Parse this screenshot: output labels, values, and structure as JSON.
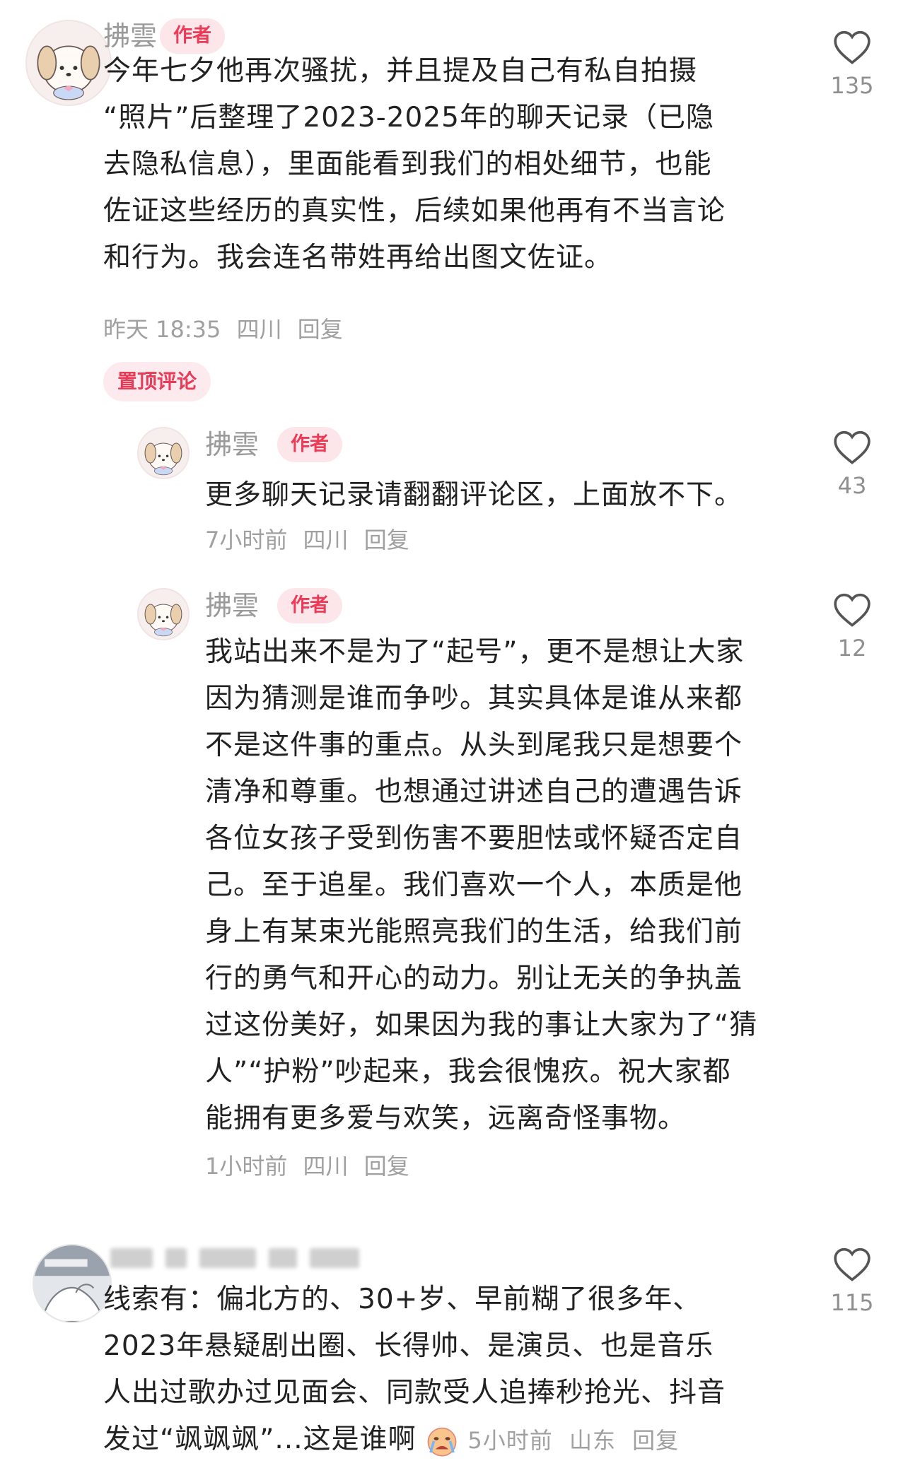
{
  "comments": [
    {
      "author": "拂雲",
      "badge": "作者",
      "lines": [
        "今年七夕他再次骚扰，并且提及自己有私自拍摄",
        "“照片”后整理了2023-2025年的聊天记录（已隐",
        "去隐私信息），里面能看到我们的相处细节，也能",
        "佐证这些经历的真实性，后续如果他再有不当言论",
        "和行为。我会连名带姓再给出图文佐证。"
      ],
      "time": "昨天 18:35",
      "location": "四川",
      "reply_label": "回复",
      "likes": "135",
      "pinned_label": "置顶评论"
    },
    {
      "author": "拂雲",
      "badge": "作者",
      "lines": [
        "更多聊天记录请翻翻评论区，上面放不下。"
      ],
      "time": "7小时前",
      "location": "四川",
      "reply_label": "回复",
      "likes": "43"
    },
    {
      "author": "拂雲",
      "badge": "作者",
      "lines": [
        "我站出来不是为了“起号”，更不是想让大家",
        "因为猜测是谁而争吵。其实具体是谁从来都",
        "不是这件事的重点。从头到尾我只是想要个",
        "清净和尊重。也想通过讲述自己的遭遇告诉",
        "各位女孩子受到伤害不要胆怯或怀疑否定自",
        "己。至于追星。我们喜欢一个人，本质是他",
        "身上有某束光能照亮我们的生活，给我们前",
        "行的勇气和开心的动力。别让无关的争执盖",
        "过这份美好，如果因为我的事让大家为了“猜",
        "人”“护粉”吵起来，我会很愧疚。祝大家都",
        "能拥有更多爱与欢笑，远离奇怪事物。"
      ],
      "time": "1小时前",
      "location": "四川",
      "reply_label": "回复",
      "likes": "12"
    },
    {
      "lines": [
        "线索有：偏北方的、30+岁、早前糊了很多年、",
        "2023年悬疑剧出圈、长得帅、是演员、也是音乐",
        "人出过歌办过见面会、同款受人追捧秒抢光、抖音",
        "发过“飒飒飒”...这是谁啊"
      ],
      "time": "5小时前",
      "location": "山东",
      "reply_label": "回复",
      "likes": "115",
      "emoji": "crying-face"
    }
  ],
  "colors": {
    "badge_text": "#ec3a57",
    "badge_bg": "#fde6ea",
    "meta": "#a0a0a0"
  }
}
